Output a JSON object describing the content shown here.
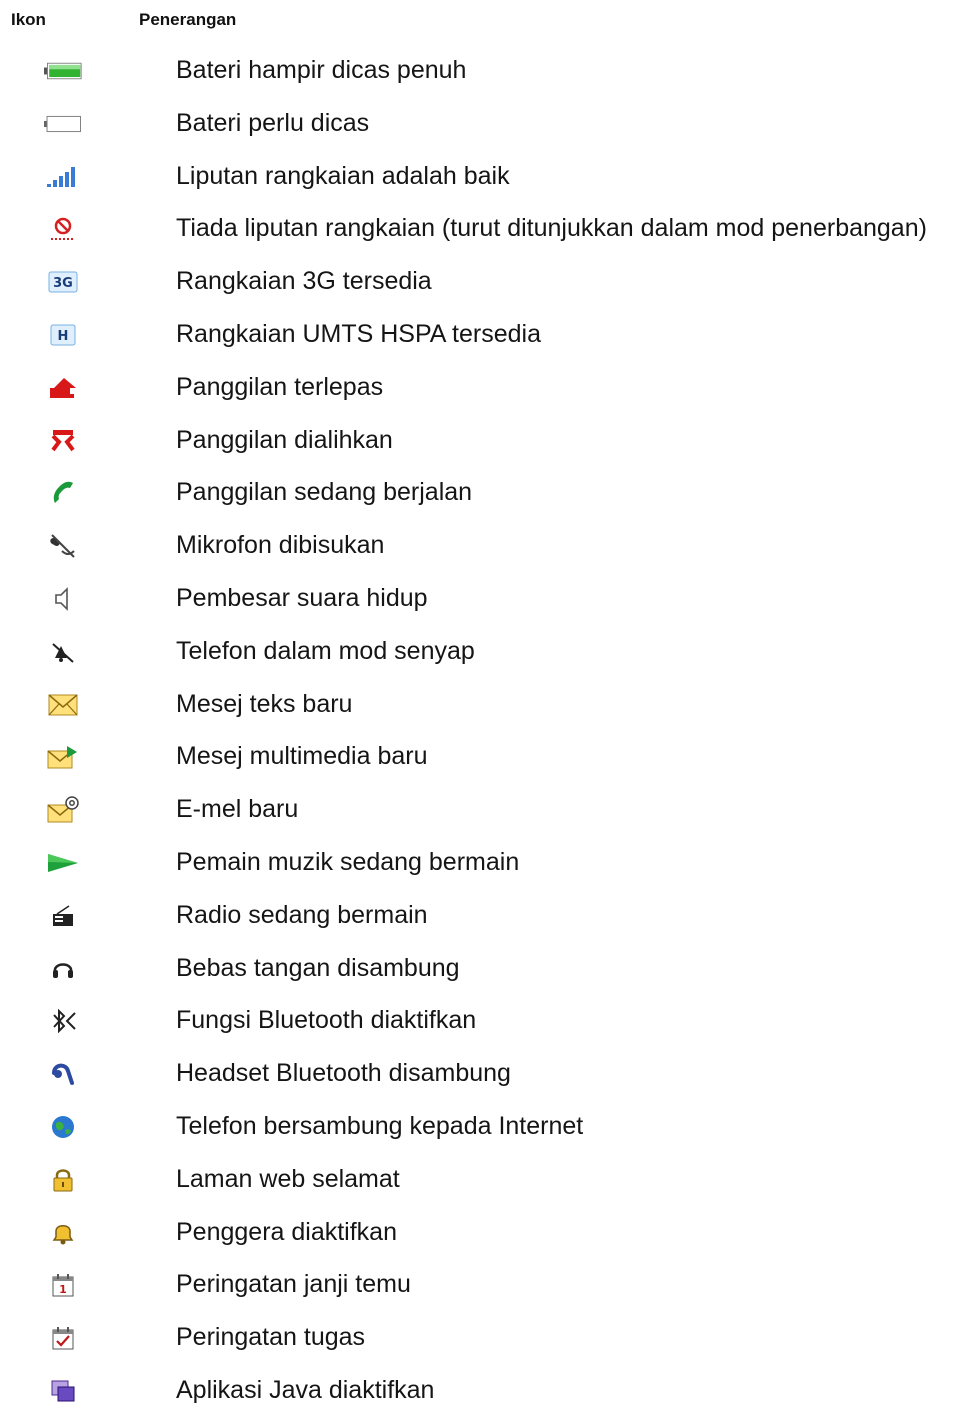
{
  "header": {
    "icon_col": "Ikon",
    "desc_col": "Penerangan"
  },
  "rows": [
    {
      "icon": "battery-full-icon",
      "label": "Bateri hampir dicas penuh"
    },
    {
      "icon": "battery-empty-icon",
      "label": "Bateri perlu dicas"
    },
    {
      "icon": "signal-strength-icon",
      "label": "Liputan rangkaian adalah baik"
    },
    {
      "icon": "no-signal-icon",
      "label": "Tiada liputan rangkaian (turut ditunjukkan dalam mod penerbangan)"
    },
    {
      "icon": "network-3g-icon",
      "label": "Rangkaian 3G tersedia"
    },
    {
      "icon": "network-hspa-icon",
      "label": "Rangkaian UMTS HSPA tersedia"
    },
    {
      "icon": "missed-call-icon",
      "label": "Panggilan terlepas"
    },
    {
      "icon": "call-divert-icon",
      "label": "Panggilan dialihkan"
    },
    {
      "icon": "ongoing-call-icon",
      "label": "Panggilan sedang berjalan"
    },
    {
      "icon": "mic-muted-icon",
      "label": "Mikrofon dibisukan"
    },
    {
      "icon": "speaker-icon",
      "label": "Pembesar suara hidup"
    },
    {
      "icon": "silent-mode-icon",
      "label": "Telefon dalam mod senyap"
    },
    {
      "icon": "text-message-icon",
      "label": "Mesej teks baru"
    },
    {
      "icon": "multimedia-message-icon",
      "label": "Mesej multimedia baru"
    },
    {
      "icon": "email-icon",
      "label": "E-mel baru"
    },
    {
      "icon": "music-play-icon",
      "label": "Pemain muzik sedang bermain"
    },
    {
      "icon": "radio-icon",
      "label": "Radio sedang bermain"
    },
    {
      "icon": "handsfree-icon",
      "label": "Bebas tangan disambung"
    },
    {
      "icon": "bluetooth-icon",
      "label": "Fungsi Bluetooth diaktifkan"
    },
    {
      "icon": "bluetooth-headset-icon",
      "label": "Headset Bluetooth disambung"
    },
    {
      "icon": "internet-globe-icon",
      "label": "Telefon bersambung kepada Internet"
    },
    {
      "icon": "padlock-icon",
      "label": "Laman web selamat"
    },
    {
      "icon": "alarm-bell-icon",
      "label": "Penggera diaktifkan"
    },
    {
      "icon": "calendar-reminder-icon",
      "label": "Peringatan janji temu"
    },
    {
      "icon": "task-reminder-icon",
      "label": "Peringatan tugas"
    },
    {
      "icon": "java-app-icon",
      "label": "Aplikasi Java diaktifkan"
    }
  ]
}
